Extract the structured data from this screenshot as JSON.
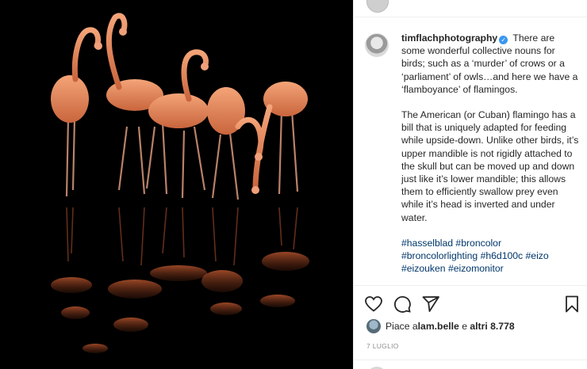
{
  "post": {
    "username": "timflachphotography",
    "verified_badge": "✓",
    "caption_paragraphs": [
      "There are some wonderful collective nouns for birds; such as a ‘murder’ of crows or a ‘parliament’ of owls…and here we have a ‘flamboyance’ of flamingos.",
      "The American (or Cuban) flamingo has a bill that is uniquely adapted for feeding while upside-down. Unlike other birds, it’s upper mandible is not rigidly attached to the skull but can be moved up and down just like it’s lower mandible; this allows them to efficiently swallow prey even while it’s head is inverted and under water."
    ],
    "hashtags": "#hasselblad #broncolor #broncolorlighting #h6d100c #eizo #eizouken #eizomonitor",
    "likes_prefix": "Piace a ",
    "likes_user": "lam.belle",
    "likes_middle": " e ",
    "likes_others": "altri 8.778",
    "date": "7 LUGLIO"
  },
  "icons": {
    "like": "heart-icon",
    "comment": "comment-icon",
    "share": "paper-plane-icon",
    "save": "bookmark-icon"
  },
  "colors": {
    "link": "#00376b",
    "verified": "#3897f0",
    "muted": "#8e8e8e",
    "flamingo": "#e98a5c"
  }
}
